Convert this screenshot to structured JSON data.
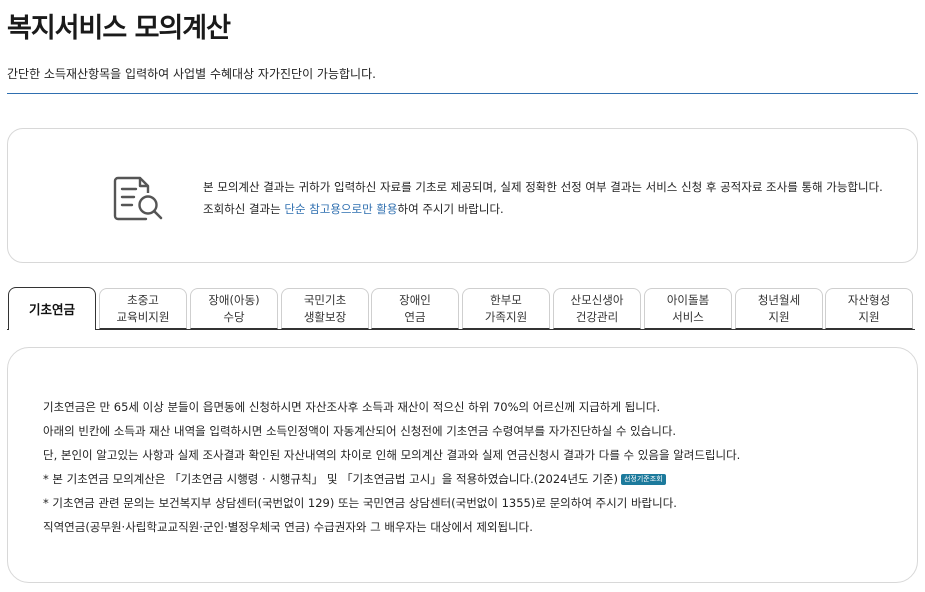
{
  "header": {
    "title": "복지서비스 모의계산",
    "subtitle": "간단한 소득재산항목을 입력하여 사업별 수혜대상 자가진단이 가능합니다."
  },
  "notice": {
    "icon": "document-search-icon",
    "text_part1": "본 모의계산 결과는 귀하가 입력하신 자료를 기초로 제공되며, 실제 정확한 선정 여부 결과는 서비스 신청 후 공적자료 조사를 통해 가능합니다. 조회하신 결과는 ",
    "text_highlight": "단순 참고용으로만 활용",
    "text_part2": "하여 주시기 바랍니다."
  },
  "tabs": [
    {
      "line1": "기초연금",
      "line2": "",
      "active": true
    },
    {
      "line1": "초중고",
      "line2": "교육비지원",
      "active": false
    },
    {
      "line1": "장애(아동)",
      "line2": "수당",
      "active": false
    },
    {
      "line1": "국민기초",
      "line2": "생활보장",
      "active": false
    },
    {
      "line1": "장애인",
      "line2": "연금",
      "active": false
    },
    {
      "line1": "한부모",
      "line2": "가족지원",
      "active": false
    },
    {
      "line1": "산모신생아",
      "line2": "건강관리",
      "active": false
    },
    {
      "line1": "아이돌봄",
      "line2": "서비스",
      "active": false
    },
    {
      "line1": "청년월세",
      "line2": "지원",
      "active": false
    },
    {
      "line1": "자산형성",
      "line2": "지원",
      "active": false
    }
  ],
  "content": {
    "lines": [
      "기초연금은 만 65세 이상 분들이 읍면동에 신청하시면 자산조사후 소득과 재산이 적으신 하위 70%의 어르신께 지급하게 됩니다.",
      "아래의 빈칸에 소득과 재산 내역을 입력하시면 소득인정액이 자동계산되어 신청전에 기초연금 수령여부를 자가진단하실 수 있습니다.",
      "단, 본인이 알고있는 사항과 실제 조사결과 확인된 자산내역의 차이로 인해 모의계산 결과와 실제 연금신청시 결과가 다를 수 있음을 알려드립니다.",
      "* 본 기초연금 모의계산은 「기초연금 시행령 · 시행규칙」 및 「기초연금법 고시」을 적용하였습니다.(2024년도 기준)",
      "* 기초연금 관련 문의는 보건복지부 상담센터(국번없이 129) 또는 국민연금 상담센터(국번없이 1355)로 문의하여 주시기 바랍니다.",
      "직역연금(공무원·사립학교교직원·군인·별정우체국 연금) 수급권자와 그 배우자는 대상에서 제외됩니다."
    ],
    "badge_label": "선정기준조회"
  },
  "colors": {
    "accent": "#2f6fb0",
    "badge": "#1c7a9c",
    "border": "#d8d8d8"
  }
}
